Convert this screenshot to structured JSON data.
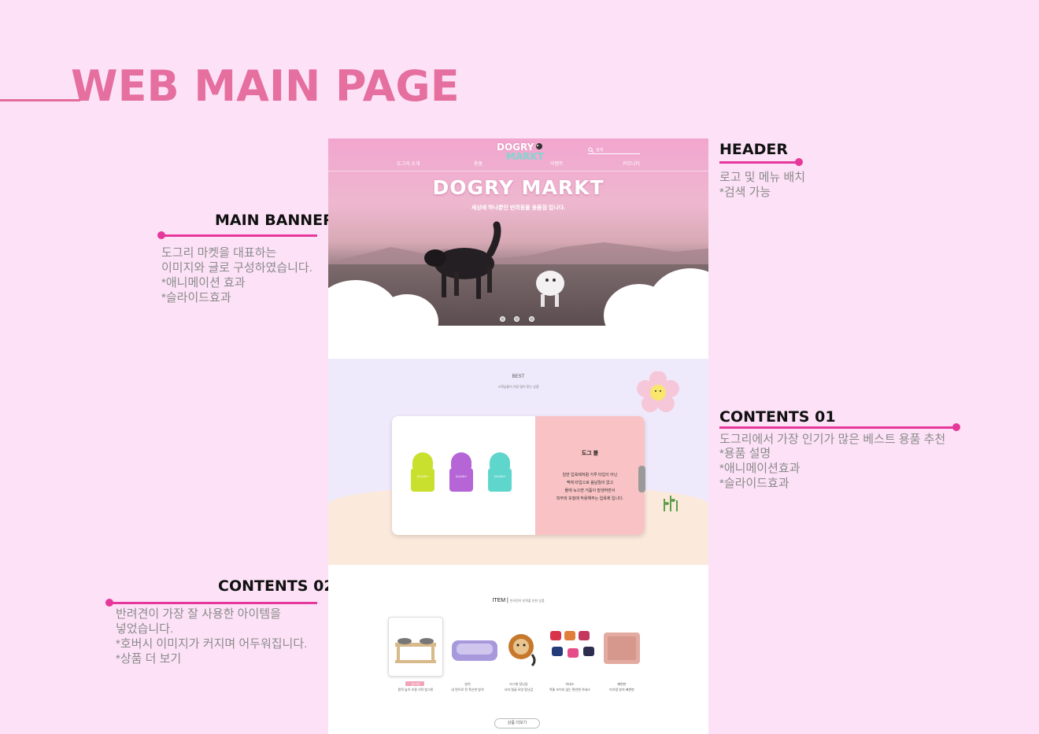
{
  "page_title": "WEB MAIN PAGE",
  "annotations": {
    "header": {
      "title": "HEADER",
      "lines": [
        "로고 및 메뉴 배치",
        "*검색 가능"
      ]
    },
    "main_banner": {
      "title": "MAIN BANNER",
      "lines": [
        "도그리 마켓을 대표하는",
        "이미지와 글로 구성하였습니다.",
        "*애니메이션 효과",
        "*슬라이드효과"
      ]
    },
    "contents01": {
      "title": "CONTENTS 01",
      "lines": [
        "도그리에서 가장 인기가 많은 베스트 용품 추천",
        "*용품 설명",
        "*애니메이션효과",
        "*슬라이드효과"
      ]
    },
    "contents02": {
      "title": "CONTENTS 02",
      "lines": [
        "반려견이 가장 잘 사용한 아이템을",
        "넣었습니다.",
        "*호버시 이미지가  커지며 어두워집니다.",
        "*상품 더 보기"
      ]
    }
  },
  "mockup": {
    "logo": {
      "line1": "DOGRY",
      "line2": "MARKT"
    },
    "search": {
      "placeholder": "검색"
    },
    "nav": [
      "도그리 소개",
      "용품",
      "이벤트",
      "커뮤니티"
    ],
    "hero": {
      "title": "DOGRY MARKT",
      "subtitle": "세상에 하나뿐인 반려동물 용품점 입니다."
    },
    "best": {
      "title": "BEST",
      "subtitle": "고객님들이 가장 많이 찾는 상품",
      "card": {
        "title": "도그 볼",
        "desc": [
          "일반 입욕제처럼 가루 타입이 아닌",
          "맥체 타입으로 음날릴이 없고",
          "물에 녹으면 거품이 발생하면서",
          "피부와 모질에 작용해주는 입욕제 입니다."
        ],
        "bottle_colors": [
          "#c9e02f",
          "#b565d6",
          "#5fd6cc"
        ],
        "bottle_label": "DOGRY"
      }
    },
    "items": {
      "title": "ITEM",
      "subtitle": "반려견이 만족할 만한 상품",
      "list": [
        {
          "tag": "밥그릇",
          "name": "원목 높이 조절 식탁 밥그릇"
        },
        {
          "tag": "방석",
          "name": "네 면으로 된 푹신한 방석"
        },
        {
          "tag": "터그봉 장난감",
          "name": "사자 얼굴 모양 장난감"
        },
        {
          "tag": "하네스",
          "name": "목줄 조이지 않는 편안한 하네스"
        },
        {
          "tag": "배변판",
          "name": "미끄럼 방지 배변판"
        }
      ],
      "more_label": "상품 더보기"
    }
  }
}
